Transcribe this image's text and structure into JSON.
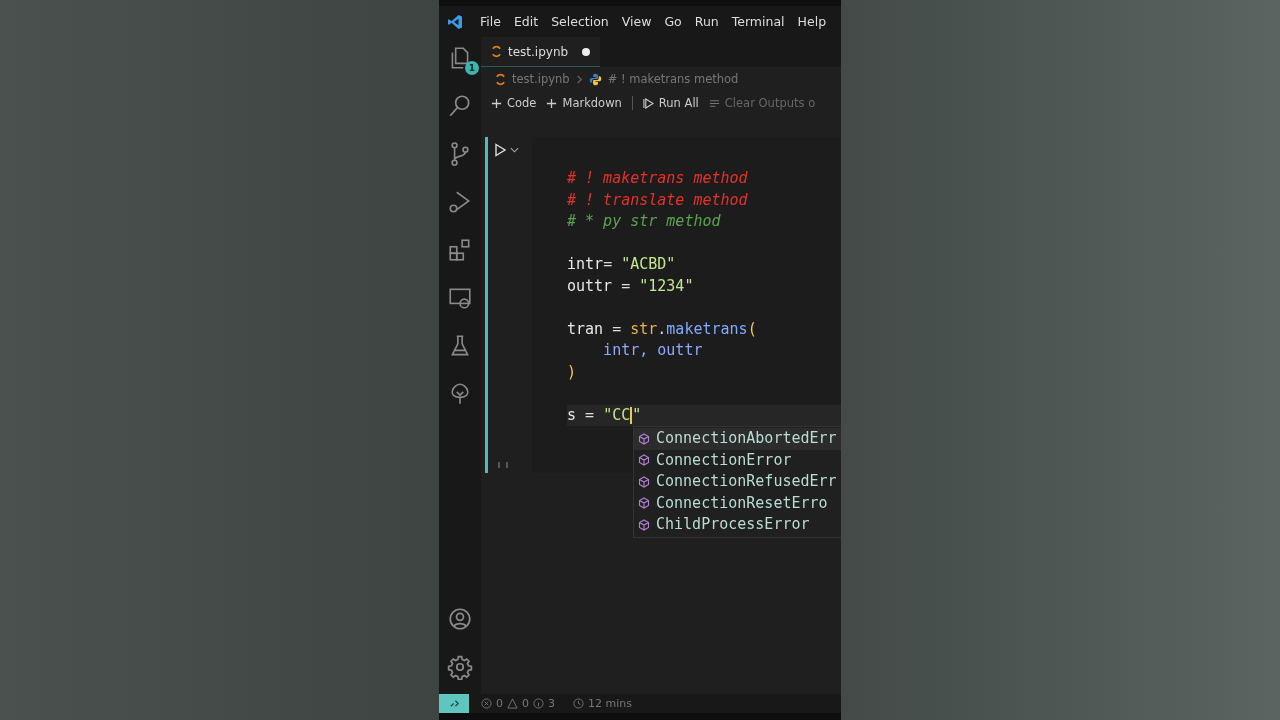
{
  "menu": [
    "File",
    "Edit",
    "Selection",
    "View",
    "Go",
    "Run",
    "Terminal",
    "Help"
  ],
  "activity_bar": {
    "explorer_badge": "1"
  },
  "tab": {
    "label": "test.ipynb",
    "dirty": true
  },
  "breadcrumb": [
    "test.ipynb",
    "# ! maketrans method"
  ],
  "toolbar": [
    {
      "label": "Code",
      "kind": "add"
    },
    {
      "label": "Markdown",
      "kind": "add"
    },
    {
      "label": "Run All",
      "kind": "run"
    },
    {
      "label": "Clear Outputs o",
      "kind": "clear"
    }
  ],
  "cell": {
    "lines": [
      {
        "kind": "code",
        "tokens": [
          {
            "text": "# ! maketrans method",
            "kind": "alert"
          }
        ]
      },
      {
        "kind": "code",
        "tokens": [
          {
            "text": "# ! translate method",
            "kind": "alert"
          }
        ]
      },
      {
        "kind": "code",
        "tokens": [
          {
            "text": "# * py str method",
            "kind": "comment"
          }
        ]
      },
      {
        "kind": "blank"
      },
      {
        "kind": "code",
        "tokens": [
          {
            "text": "intr",
            "kind": "var"
          },
          {
            "text": "= ",
            "kind": "op"
          },
          {
            "text": "\"ACBD\"",
            "kind": "string"
          }
        ]
      },
      {
        "kind": "code",
        "tokens": [
          {
            "text": "outtr",
            "kind": "var"
          },
          {
            "text": " = ",
            "kind": "op"
          },
          {
            "text": "\"1234\"",
            "kind": "string"
          }
        ]
      },
      {
        "kind": "blank"
      },
      {
        "kind": "code",
        "tokens": [
          {
            "text": "tran",
            "kind": "var"
          },
          {
            "text": " = ",
            "kind": "op"
          },
          {
            "text": "str",
            "kind": "type"
          },
          {
            "text": ".",
            "kind": "op"
          },
          {
            "text": "maketrans",
            "kind": "func"
          },
          {
            "text": "(",
            "kind": "paren"
          }
        ]
      },
      {
        "kind": "code",
        "tokens": [
          {
            "text": "    intr, outtr",
            "kind": "param"
          }
        ]
      },
      {
        "kind": "code",
        "tokens": [
          {
            "text": ")",
            "kind": "paren"
          }
        ]
      },
      {
        "kind": "blank"
      },
      {
        "kind": "code",
        "tokens": [
          {
            "text": "s",
            "kind": "var"
          },
          {
            "text": " = ",
            "kind": "op"
          },
          {
            "text": "\"CC",
            "kind": "string"
          },
          {
            "kind": "cursor"
          },
          {
            "text": "\"",
            "kind": "string"
          }
        ]
      }
    ]
  },
  "suggestions": [
    {
      "label": "ConnectionAbortedErr",
      "selected": true
    },
    {
      "label": "ConnectionError",
      "selected": false
    },
    {
      "label": "ConnectionRefusedErr",
      "selected": false
    },
    {
      "label": "ConnectionResetErro",
      "selected": false
    },
    {
      "label": "ChildProcessError",
      "selected": false
    }
  ],
  "status_bar": {
    "errors": "0",
    "warnings": "0",
    "info": "3",
    "time": "12 mins"
  }
}
